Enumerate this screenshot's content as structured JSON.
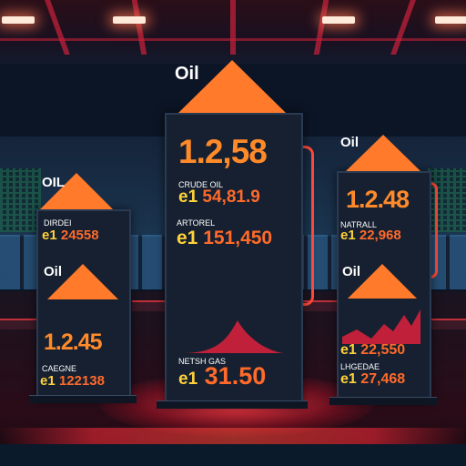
{
  "title_label": "Oil",
  "center": {
    "big_value": "1.2,58",
    "row1_label": "CRUDE OIL",
    "row1_prefix": "e1",
    "row1_value": "54,81.9",
    "row2_label": "ARTOREL",
    "row2_prefix": "e1",
    "row2_value": "151,450",
    "row3_label": "NETSH GAS",
    "row3_prefix": "e1",
    "row3_value": "31.50"
  },
  "left": {
    "top_label": "OIL",
    "row1_label": "DIRDEI",
    "row1_prefix": "e1",
    "row1_value": "24558",
    "mid_label": "Oil",
    "big_value": "1.2.45",
    "row2_label": "CAEGNE",
    "row2_prefix": "e1",
    "row2_value": "122138"
  },
  "right": {
    "top_label": "Oil",
    "big_value": "1.2.48",
    "row1_label": "NATRALL",
    "row1_prefix": "e1",
    "row1_value": "22,968",
    "mid_label": "Oil",
    "row2_prefix": "e1",
    "row2_value": "22,550",
    "row3_label": "LHGEDAE",
    "row3_prefix": "e1",
    "row3_value": "27,468"
  },
  "colors": {
    "accent": "#ff6a2a",
    "triangle_top": "#ff9a2a",
    "triangle_bottom": "#e0203a",
    "prefix": "#ffd23a",
    "panel": "#162030"
  }
}
